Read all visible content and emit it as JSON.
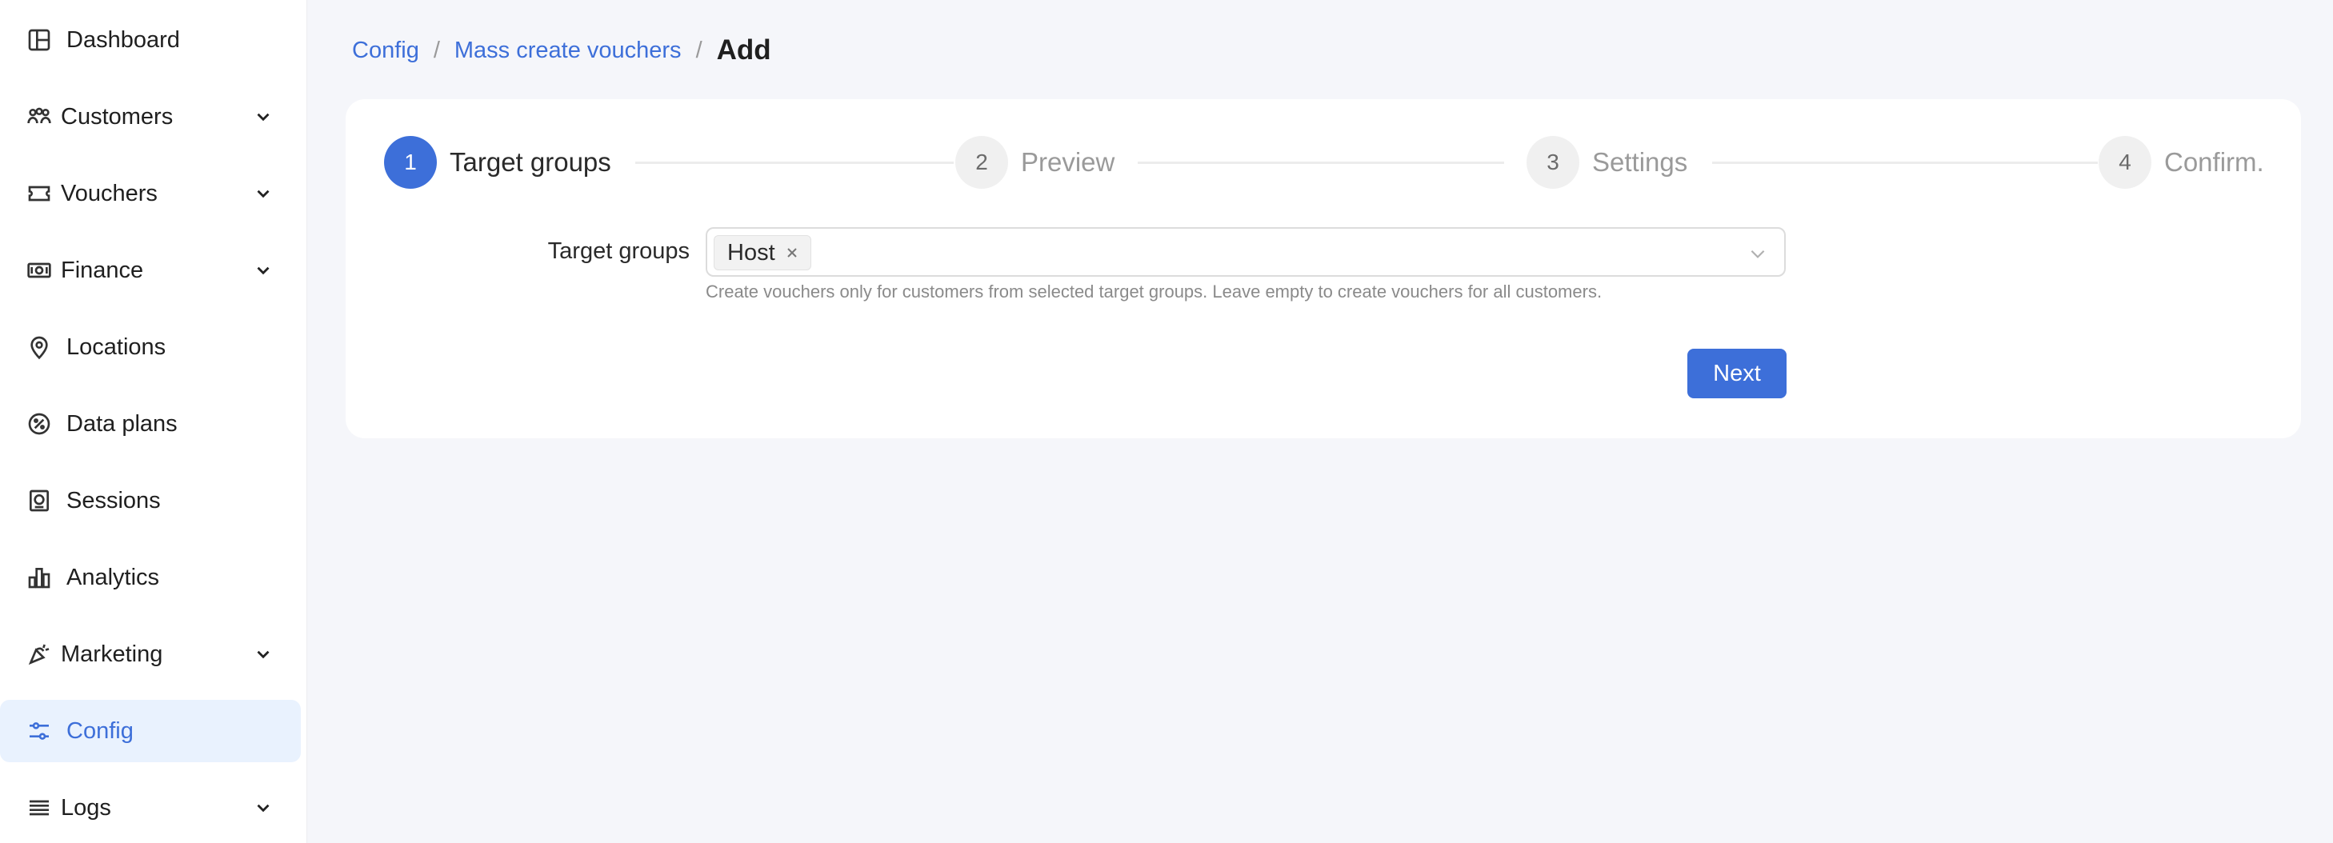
{
  "sidebar": {
    "items": [
      {
        "label": "Dashboard",
        "icon": "dashboard-icon",
        "has_submenu": false
      },
      {
        "label": "Customers",
        "icon": "customers-icon",
        "has_submenu": true
      },
      {
        "label": "Vouchers",
        "icon": "voucher-icon",
        "has_submenu": true
      },
      {
        "label": "Finance",
        "icon": "finance-icon",
        "has_submenu": true
      },
      {
        "label": "Locations",
        "icon": "location-pin-icon",
        "has_submenu": false
      },
      {
        "label": "Data plans",
        "icon": "percent-icon",
        "has_submenu": false
      },
      {
        "label": "Sessions",
        "icon": "sessions-icon",
        "has_submenu": false
      },
      {
        "label": "Analytics",
        "icon": "bar-chart-icon",
        "has_submenu": false
      },
      {
        "label": "Marketing",
        "icon": "megaphone-icon",
        "has_submenu": true
      },
      {
        "label": "Config",
        "icon": "sliders-icon",
        "has_submenu": false,
        "active": true
      },
      {
        "label": "Logs",
        "icon": "list-icon",
        "has_submenu": true
      }
    ]
  },
  "breadcrumb": {
    "items": [
      "Config",
      "Mass create vouchers"
    ],
    "separator": "/",
    "current": "Add"
  },
  "steps": [
    {
      "number": "1",
      "label": "Target groups",
      "active": true
    },
    {
      "number": "2",
      "label": "Preview",
      "active": false
    },
    {
      "number": "3",
      "label": "Settings",
      "active": false
    },
    {
      "number": "4",
      "label": "Confirm.",
      "active": false
    }
  ],
  "form": {
    "target_groups_label": "Target groups",
    "selected_tags": [
      "Host"
    ],
    "help_text": "Create vouchers only for customers from selected target groups. Leave empty to create vouchers for all customers.",
    "next_label": "Next"
  },
  "colors": {
    "accent": "#3d6fd9",
    "active_bg": "#e9f2fe",
    "page_bg": "#f5f6fa"
  }
}
